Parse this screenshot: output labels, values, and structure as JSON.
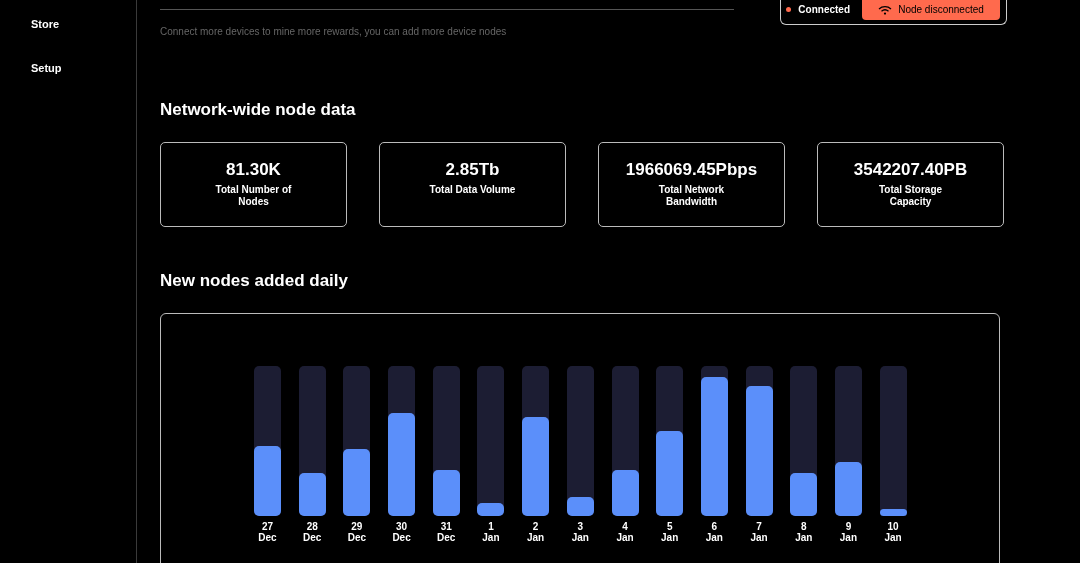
{
  "sidebar": {
    "items": [
      {
        "label": "Store"
      },
      {
        "label": "Setup"
      }
    ]
  },
  "header": {
    "subtitle": "Connect more devices to mine more rewards, you can add more device nodes"
  },
  "status": {
    "connected_label": "Connected",
    "button": "Node disconnected"
  },
  "network": {
    "title": "Network-wide node data",
    "stats": [
      {
        "value": "81.30K",
        "label": "Total Number of Nodes"
      },
      {
        "value": "2.85Tb",
        "label": "Total Data Volume"
      },
      {
        "value": "1966069.45Pbps",
        "label": "Total Network Bandwidth"
      },
      {
        "value": "3542207.40PB",
        "label": "Total Storage Capacity"
      }
    ]
  },
  "daily": {
    "title": "New nodes added daily",
    "days": [
      {
        "day": "27",
        "month": "Dec",
        "level": 0.47
      },
      {
        "day": "28",
        "month": "Dec",
        "level": 0.29
      },
      {
        "day": "29",
        "month": "Dec",
        "level": 0.45
      },
      {
        "day": "30",
        "month": "Dec",
        "level": 0.69
      },
      {
        "day": "31",
        "month": "Dec",
        "level": 0.31
      },
      {
        "day": "1",
        "month": "Jan",
        "level": 0.09
      },
      {
        "day": "2",
        "month": "Jan",
        "level": 0.66
      },
      {
        "day": "3",
        "month": "Jan",
        "level": 0.13
      },
      {
        "day": "4",
        "month": "Jan",
        "level": 0.31
      },
      {
        "day": "5",
        "month": "Jan",
        "level": 0.57
      },
      {
        "day": "6",
        "month": "Jan",
        "level": 0.93
      },
      {
        "day": "7",
        "month": "Jan",
        "level": 0.87
      },
      {
        "day": "8",
        "month": "Jan",
        "level": 0.29
      },
      {
        "day": "9",
        "month": "Jan",
        "level": 0.36
      },
      {
        "day": "10",
        "month": "Jan",
        "level": 0.05
      }
    ]
  }
}
